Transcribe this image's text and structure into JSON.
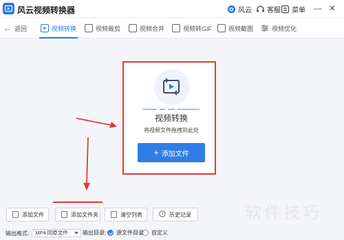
{
  "app": {
    "title": "风云视频转换器"
  },
  "titlebar": {
    "account_label": "风云",
    "service_label": "客服",
    "menu_label": "菜单",
    "minimize_glyph": "—",
    "close_glyph": "✕"
  },
  "nav": {
    "back_label": "返回",
    "tabs": [
      {
        "label": "视频转换",
        "icon": "video-convert-icon",
        "active": true
      },
      {
        "label": "视频裁剪",
        "icon": "video-crop-icon"
      },
      {
        "label": "视频合并",
        "icon": "video-merge-icon"
      },
      {
        "label": "视频转GIF",
        "icon": "gif-icon"
      },
      {
        "label": "视频截图",
        "icon": "screenshot-icon"
      },
      {
        "label": "视频优化",
        "icon": "optimize-icon"
      }
    ]
  },
  "drop_area": {
    "title": "视频转换",
    "subtitle": "将视频文件拖拽到此处",
    "add_button_label": "添加文件",
    "add_button_glyph": "+"
  },
  "actions": {
    "add_file": "添加文件",
    "add_folder": "添加文件夹",
    "clear_list": "清空列表",
    "history": "历史记录"
  },
  "status": {
    "output_format_label": "输出格式:",
    "output_format_value": "MP4 同原文件",
    "output_dir_label": "输出目录:",
    "dir_option_source": "源文件目录",
    "dir_option_custom": "自定义"
  },
  "watermark": {
    "text": "软件技巧"
  },
  "colors": {
    "accent": "#2f7de6",
    "annotation_red": "#e23a3a"
  }
}
